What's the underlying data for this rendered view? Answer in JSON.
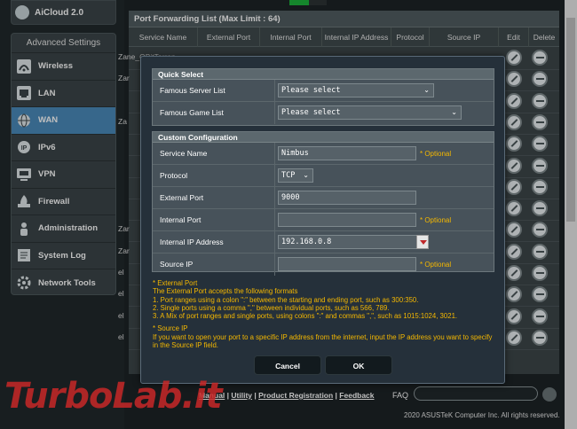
{
  "sidebar": {
    "aicloud_label": "AiCloud 2.0",
    "advanced_title": "Advanced Settings",
    "items": [
      {
        "label": "Wireless"
      },
      {
        "label": "LAN"
      },
      {
        "label": "WAN"
      },
      {
        "label": "IPv6"
      },
      {
        "label": "VPN"
      },
      {
        "label": "Firewall"
      },
      {
        "label": "Administration"
      },
      {
        "label": "System Log"
      },
      {
        "label": "Network Tools"
      }
    ]
  },
  "pfl": {
    "title": "Port Forwarding List (Max Limit : 64)",
    "headers": [
      "Service Name",
      "External Port",
      "Internal Port",
      "Internal IP Address",
      "Protocol",
      "Source IP",
      "Edit",
      "Delete"
    ],
    "rows": [
      "Zane_QBitTorren",
      "Zar",
      "",
      "Za",
      "",
      "",
      "",
      "",
      "Zar",
      "Zar",
      "el",
      "el",
      "el",
      "el"
    ]
  },
  "modal": {
    "quick_select_title": "Quick Select",
    "famous_server_label": "Famous Server List",
    "famous_server_value": "Please select",
    "famous_game_label": "Famous Game List",
    "famous_game_value": "Please select",
    "custom_title": "Custom Configuration",
    "service_name_label": "Service Name",
    "service_name_value": "Nimbus",
    "optional_text": "* Optional",
    "protocol_label": "Protocol",
    "protocol_value": "TCP",
    "external_port_label": "External Port",
    "external_port_value": "9000",
    "internal_port_label": "Internal Port",
    "internal_port_value": "",
    "internal_ip_label": "Internal IP Address",
    "internal_ip_value": "192.168.0.8",
    "source_ip_label": "Source IP",
    "source_ip_value": "",
    "notes": [
      "* External Port",
      "The External Port accepts the following formats",
      "1. Port ranges using a colon \":\" between the starting and ending port, such as 300:350.",
      "2. Single ports using a comma \",\" between individual ports, such as 566, 789.",
      "3. A Mix of port ranges and single ports, using colons \":\" and commas \",\", such as 1015:1024, 3021.",
      "",
      "* Source IP",
      "If you want to open your port to a specific IP address from the internet, input the IP address you want to specify",
      "in the Source IP field."
    ],
    "cancel_label": "Cancel",
    "ok_label": "OK"
  },
  "footer": {
    "manual": "Manual",
    "sep1": " | ",
    "utility": "Utility",
    "sep2": " | ",
    "product_registration": "Product Registration",
    "sep3": " | ",
    "feedback": "Feedback",
    "faq_label": "FAQ",
    "copyright": "2020 ASUSTeK Computer Inc. All rights reserved."
  },
  "watermark": "TurboLab.it",
  "colors": {
    "accent_active": "#4a8aba",
    "optional_yellow": "#f5b800",
    "toggle_green": "#1db33b"
  }
}
